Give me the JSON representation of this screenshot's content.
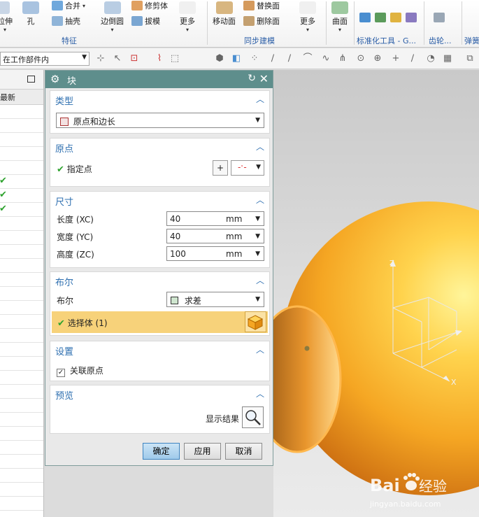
{
  "ribbon": {
    "left_cut_label": "拉伸",
    "hole_label": "孔",
    "combine_label": "合并",
    "shell_label": "抽壳",
    "edge_blend_label": "边倒圆",
    "trim_body_label": "修剪体",
    "draft_label": "拔模",
    "more_label_1": "更多",
    "move_face_label": "移动面",
    "replace_face_label": "替换面",
    "delete_face_label": "删除面",
    "more_label_2": "更多",
    "surface_label": "曲面",
    "group_feature": "特征",
    "group_sync": "同步建模",
    "group_std_tools": "标准化工具 - G...",
    "group_gear": "齿轮...",
    "group_spring": "弹簧"
  },
  "toolbar": {
    "filter_value": "在工作部件内"
  },
  "navigator": {
    "column_header": "最新",
    "checked_rows": [
      5,
      6,
      7
    ]
  },
  "dialog": {
    "title": "块",
    "type": {
      "title": "类型",
      "value": "原点和边长"
    },
    "origin": {
      "title": "原点",
      "specify_point": "指定点"
    },
    "dimensions": {
      "title": "尺寸",
      "length_label": "长度 (XC)",
      "length_value": "40",
      "width_label": "宽度 (YC)",
      "width_value": "40",
      "height_label": "高度 (ZC)",
      "height_value": "100",
      "unit": "mm"
    },
    "boolean": {
      "title": "布尔",
      "label": "布尔",
      "value": "求差",
      "select_body": "选择体 (1)"
    },
    "settings": {
      "title": "设置",
      "associative_origin": "关联原点"
    },
    "preview": {
      "title": "预览",
      "show_result": "显示结果"
    },
    "buttons": {
      "ok": "确定",
      "apply": "应用",
      "cancel": "取消"
    }
  },
  "viewport": {
    "axis_x": "X",
    "axis_z": "Z",
    "sphere_color": "#f5a623"
  },
  "watermark": {
    "brand": "Bai",
    "brand2": "经验",
    "url": "jingyan.baidu.com"
  },
  "colors": {
    "accent": "#2e6fb0",
    "title_bar": "#5e8e8c",
    "select_highlight": "#f7d27a",
    "check": "#2fa32f"
  }
}
